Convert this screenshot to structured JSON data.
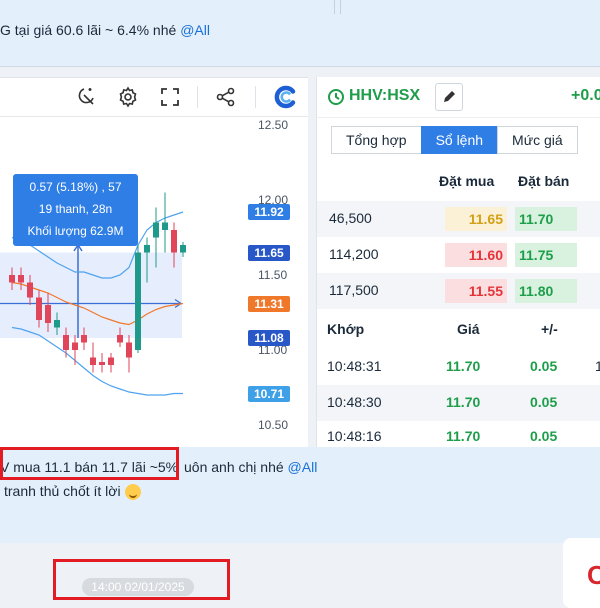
{
  "chat_top": {
    "text": "G tại giá 60.6 lãi ~ 6.4% nhé",
    "mention": "@All"
  },
  "chart": {
    "toolbar_icons": [
      "magic-wand-icon",
      "gear-icon",
      "fullscreen-icon",
      "share-icon",
      "brand-c-icon"
    ],
    "y_ticks": [
      "12.50",
      "12.00",
      "11.50",
      "11.00",
      "10.50"
    ],
    "price_tags": [
      {
        "label": "11.92",
        "color": "#2f7ee6"
      },
      {
        "label": "11.65",
        "color": "#2857c8"
      },
      {
        "label": "11.31",
        "color": "#f0782b"
      },
      {
        "label": "11.08",
        "color": "#2857c8"
      },
      {
        "label": "10.71",
        "color": "#3ea0e6"
      }
    ],
    "tooltip": {
      "line1": "0.57 (5.18%) , 57",
      "line2": "19 thanh, 28n",
      "line3": "Khối lượng 62.9M"
    }
  },
  "chart_data": {
    "type": "candlestick",
    "title": "",
    "ylim": [
      10.45,
      12.6
    ],
    "candles": [
      {
        "o": 11.45,
        "h": 11.55,
        "l": 11.4,
        "c": 11.5,
        "dir": "down"
      },
      {
        "o": 11.5,
        "h": 11.55,
        "l": 11.4,
        "c": 11.45,
        "dir": "down"
      },
      {
        "o": 11.45,
        "h": 11.5,
        "l": 11.3,
        "c": 11.35,
        "dir": "down"
      },
      {
        "o": 11.35,
        "h": 11.4,
        "l": 11.15,
        "c": 11.2,
        "dir": "down"
      },
      {
        "o": 11.3,
        "h": 11.38,
        "l": 11.12,
        "c": 11.18,
        "dir": "down"
      },
      {
        "o": 11.2,
        "h": 11.25,
        "l": 11.1,
        "c": 11.15,
        "dir": "up"
      },
      {
        "o": 11.1,
        "h": 11.15,
        "l": 10.95,
        "c": 11.0,
        "dir": "down"
      },
      {
        "o": 11.05,
        "h": 11.1,
        "l": 10.9,
        "c": 11.0,
        "dir": "down"
      },
      {
        "o": 11.05,
        "h": 11.15,
        "l": 11.0,
        "c": 11.1,
        "dir": "down"
      },
      {
        "o": 10.95,
        "h": 11.05,
        "l": 10.85,
        "c": 10.9,
        "dir": "down"
      },
      {
        "o": 10.9,
        "h": 10.98,
        "l": 10.85,
        "c": 10.92,
        "dir": "down"
      },
      {
        "o": 10.95,
        "h": 10.98,
        "l": 10.85,
        "c": 10.9,
        "dir": "down"
      },
      {
        "o": 11.1,
        "h": 11.15,
        "l": 11.02,
        "c": 11.05,
        "dir": "down"
      },
      {
        "o": 11.05,
        "h": 11.1,
        "l": 10.85,
        "c": 10.95,
        "dir": "down"
      },
      {
        "o": 11.0,
        "h": 11.7,
        "l": 10.98,
        "c": 11.65,
        "dir": "up"
      },
      {
        "o": 11.65,
        "h": 11.75,
        "l": 11.45,
        "c": 11.7,
        "dir": "up"
      },
      {
        "o": 11.75,
        "h": 11.95,
        "l": 11.55,
        "c": 11.85,
        "dir": "up"
      },
      {
        "o": 11.85,
        "h": 12.05,
        "l": 11.65,
        "c": 11.8,
        "dir": "up"
      },
      {
        "o": 11.8,
        "h": 11.85,
        "l": 11.55,
        "c": 11.65,
        "dir": "down"
      },
      {
        "o": 11.7,
        "h": 11.72,
        "l": 11.62,
        "c": 11.65,
        "dir": "up"
      }
    ],
    "bands": {
      "upper": [
        11.75,
        11.73,
        11.7,
        11.66,
        11.62,
        11.58,
        11.55,
        11.52,
        11.52,
        11.5,
        11.48,
        11.48,
        11.5,
        11.55,
        11.7,
        11.8,
        11.85,
        11.88,
        11.9,
        11.92
      ],
      "middle": [
        11.45,
        11.44,
        11.42,
        11.4,
        11.38,
        11.35,
        11.32,
        11.3,
        11.28,
        11.25,
        11.22,
        11.2,
        11.18,
        11.17,
        11.2,
        11.24,
        11.27,
        11.29,
        11.3,
        11.31
      ],
      "lower": [
        11.15,
        11.14,
        11.12,
        11.1,
        11.06,
        11.02,
        10.98,
        10.93,
        10.88,
        10.83,
        10.79,
        10.76,
        10.74,
        10.72,
        10.71,
        10.7,
        10.7,
        10.7,
        10.71,
        10.71
      ]
    }
  },
  "quote": {
    "symbol": "HHV:HSX",
    "change": "+0.0"
  },
  "tabs": [
    "Tổng hợp",
    "Sổ lệnh",
    "Mức giá"
  ],
  "orderbook": {
    "headers": {
      "buy": "Đặt mua",
      "sell": "Đặt bán"
    },
    "rows": [
      {
        "volume": "46,500",
        "bid": "11.65",
        "ask": "11.70",
        "bid_color": "#d4a017"
      },
      {
        "volume": "114,200",
        "bid": "11.60",
        "ask": "11.75",
        "bid_color": "#e5333a"
      },
      {
        "volume": "117,500",
        "bid": "11.55",
        "ask": "11.80",
        "bid_color": "#e5333a"
      }
    ]
  },
  "trades": {
    "headers": {
      "time": "Khớp",
      "price": "Giá",
      "change": "+/-"
    },
    "rows": [
      {
        "time": "10:48:31",
        "price": "11.70",
        "change": "0.05"
      },
      {
        "time": "10:48:30",
        "price": "11.70",
        "change": "0.05"
      },
      {
        "time": "10:48:16",
        "price": "11.70",
        "change": "0.05"
      }
    ],
    "extra_digit": "1"
  },
  "chat_mid": {
    "line1_boxed": "V mua 11.1 bán 11.7 lãi ~5%",
    "line1_rest": "uôn anh chị nhé",
    "mention": "@All",
    "line2": "tranh thủ chốt ít lời"
  },
  "timestamp": "14:00 02/01/2025",
  "card_letter": "C"
}
